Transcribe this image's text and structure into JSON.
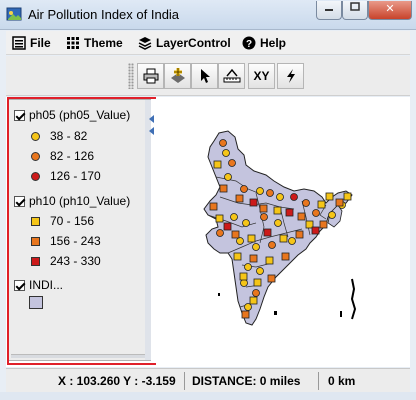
{
  "window": {
    "title": "Air Pollution Index of India",
    "close_label": "✕"
  },
  "menu": {
    "file": "File",
    "theme": "Theme",
    "layer_control": "LayerControl",
    "help": "Help"
  },
  "toolbar": {
    "xy_label": "XY"
  },
  "legend": {
    "layers": [
      {
        "name": "ph05 (ph05_Value)",
        "checked": true,
        "symbol": "circle",
        "classes": [
          {
            "label": "38 - 82",
            "color": "#f5c518"
          },
          {
            "label": "82 - 126",
            "color": "#e8761e"
          },
          {
            "label": "126 - 170",
            "color": "#cc1a1a"
          }
        ]
      },
      {
        "name": "ph10 (ph10_Value)",
        "checked": true,
        "symbol": "square",
        "classes": [
          {
            "label": "70 - 156",
            "color": "#f5c518"
          },
          {
            "label": "156 - 243",
            "color": "#e8761e"
          },
          {
            "label": "243 - 330",
            "color": "#cc1a1a"
          }
        ]
      },
      {
        "name": "INDI...",
        "checked": true,
        "symbol": "polygon",
        "color": "#c4c4de"
      }
    ]
  },
  "status": {
    "coords": "X : 103.260 Y : -3.159",
    "distance": "DISTANCE:  0 miles",
    "km": "0 km"
  },
  "colors": {
    "selection": "#e0202a",
    "map_fill": "#c4c4de",
    "low": "#f5c518",
    "mid": "#e8761e",
    "high": "#cc1a1a"
  }
}
